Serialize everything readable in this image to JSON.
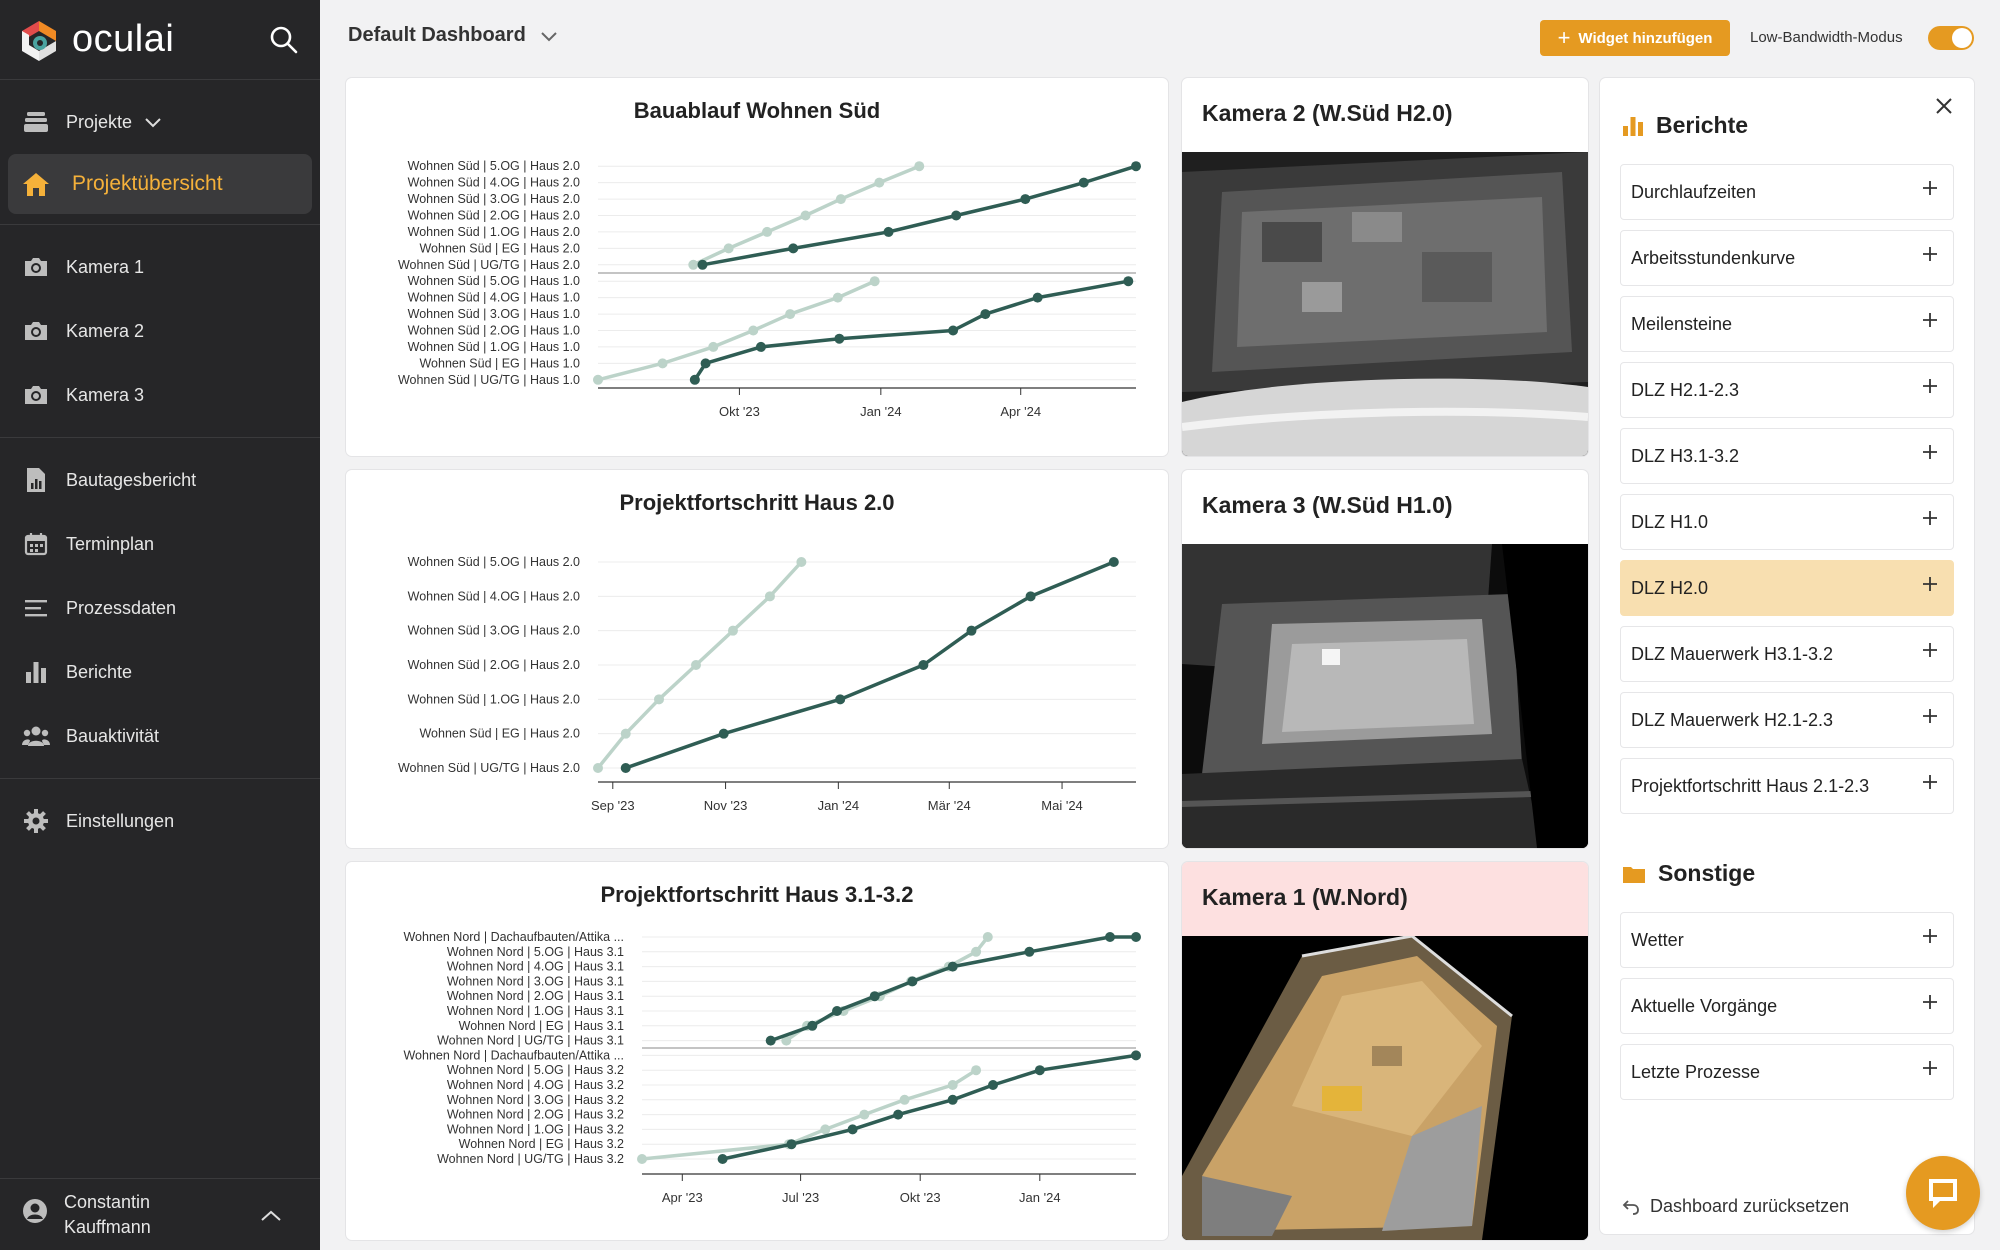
{
  "brand": {
    "name": "oculai"
  },
  "sidebar": {
    "projects": "Projekte",
    "overview": "Projektübersicht",
    "cameras": [
      "Kamera 1",
      "Kamera 2",
      "Kamera 3"
    ],
    "tools": [
      "Bautagesbericht",
      "Terminplan",
      "Prozessdaten",
      "Berichte",
      "Bauaktivität"
    ],
    "settings": "Einstellungen",
    "user": {
      "first": "Constantin",
      "last": "Kauffmann"
    }
  },
  "topbar": {
    "dashboard": "Default Dashboard",
    "add_widget": "Widget hinzufügen",
    "low_bandwidth": "Low-Bandwidth-Modus",
    "low_bandwidth_on": true
  },
  "colors": {
    "accent": "#e59a21",
    "plan": "#bcd3c9",
    "actual": "#2f5d54",
    "camera1_header": "#fde0e0"
  },
  "cameras": {
    "cam2": {
      "title": "Kamera 2 (W.Süd H2.0)"
    },
    "cam3": {
      "title": "Kamera 3 (W.Süd H1.0)"
    },
    "cam1": {
      "title": "Kamera 1 (W.Nord)"
    }
  },
  "chart_data": [
    {
      "type": "line",
      "title": "Bauablauf Wohnen Süd",
      "x_ticks": [
        "Okt '23",
        "Jan '24",
        "Apr '24"
      ],
      "x_range": [
        "2023-07-01",
        "2024-06-15"
      ],
      "categories": [
        "Wohnen Süd | 5.OG | Haus 2.0",
        "Wohnen Süd | 4.OG | Haus 2.0",
        "Wohnen Süd | 3.OG | Haus 2.0",
        "Wohnen Süd | 2.OG | Haus 2.0",
        "Wohnen Süd | 1.OG | Haus 2.0",
        "Wohnen Süd | EG | Haus 2.0",
        "Wohnen Süd | UG/TG | Haus 2.0",
        "Wohnen Süd | 5.OG | Haus 1.0",
        "Wohnen Süd | 4.OG | Haus 1.0",
        "Wohnen Süd | 3.OG | Haus 1.0",
        "Wohnen Süd | 2.OG | Haus 1.0",
        "Wohnen Süd | 1.OG | Haus 1.0",
        "Wohnen Süd | EG | Haus 1.0",
        "Wohnen Süd | UG/TG | Haus 1.0"
      ],
      "series": [
        {
          "role": "plan",
          "values": [
            [
              "2023-09-01",
              6.5
            ],
            [
              "2023-09-24",
              5.5
            ],
            [
              "2023-10-19",
              4.5
            ],
            [
              "2023-11-13",
              3.5
            ],
            [
              "2023-12-06",
              2.5
            ],
            [
              "2023-12-31",
              1.5
            ],
            [
              "2024-01-26",
              0.5
            ]
          ],
          "group": 0
        },
        {
          "role": "actual",
          "values": [
            [
              "2023-09-07",
              6.5
            ],
            [
              "2023-11-05",
              5.5
            ],
            [
              "2024-01-06",
              4.5
            ],
            [
              "2024-02-19",
              3.5
            ],
            [
              "2024-04-04",
              2.5
            ],
            [
              "2024-05-12",
              1.5
            ],
            [
              "2024-06-15",
              0.5
            ]
          ],
          "group": 0
        },
        {
          "role": "plan",
          "values": [
            [
              "2023-07-01",
              13.5
            ],
            [
              "2023-08-12",
              12.5
            ],
            [
              "2023-09-14",
              11.5
            ],
            [
              "2023-10-10",
              10.5
            ],
            [
              "2023-11-03",
              9.5
            ],
            [
              "2023-12-04",
              8.5
            ],
            [
              "2023-12-28",
              7.5
            ]
          ],
          "group": 1
        },
        {
          "role": "actual",
          "values": [
            [
              "2023-09-02",
              13.5
            ],
            [
              "2023-09-09",
              12.5
            ],
            [
              "2023-10-15",
              11.5
            ],
            [
              "2023-12-05",
              11.0
            ],
            [
              "2024-02-17",
              10.5
            ],
            [
              "2024-03-09",
              9.5
            ],
            [
              "2024-04-12",
              8.5
            ],
            [
              "2024-06-10",
              7.5
            ]
          ],
          "group": 1
        }
      ]
    },
    {
      "type": "line",
      "title": "Projektfortschritt Haus 2.0",
      "x_ticks": [
        "Sep '23",
        "Nov '23",
        "Jan '24",
        "Mär '24",
        "Mai '24"
      ],
      "x_range": [
        "2023-08-24",
        "2024-06-10"
      ],
      "categories": [
        "Wohnen Süd | 5.OG | Haus 2.0",
        "Wohnen Süd | 4.OG | Haus 2.0",
        "Wohnen Süd | 3.OG | Haus 2.0",
        "Wohnen Süd | 2.OG | Haus 2.0",
        "Wohnen Süd | 1.OG | Haus 2.0",
        "Wohnen Süd | EG | Haus 2.0",
        "Wohnen Süd | UG/TG | Haus 2.0"
      ],
      "series": [
        {
          "role": "plan",
          "values": [
            [
              "2023-08-24",
              6.0
            ],
            [
              "2023-09-08",
              5.0
            ],
            [
              "2023-09-26",
              4.0
            ],
            [
              "2023-10-16",
              3.0
            ],
            [
              "2023-11-05",
              2.0
            ],
            [
              "2023-11-25",
              1.0
            ],
            [
              "2023-12-12",
              0.0
            ]
          ],
          "group": 0
        },
        {
          "role": "actual",
          "values": [
            [
              "2023-09-08",
              6.0
            ],
            [
              "2023-10-31",
              5.0
            ],
            [
              "2024-01-02",
              4.0
            ],
            [
              "2024-02-16",
              3.0
            ],
            [
              "2024-03-13",
              2.0
            ],
            [
              "2024-04-14",
              1.0
            ],
            [
              "2024-05-29",
              0.0
            ]
          ],
          "group": 0
        }
      ]
    },
    {
      "type": "line",
      "title": "Projektfortschritt Haus 3.1-3.2",
      "x_ticks": [
        "Apr '23",
        "Jul '23",
        "Okt '23",
        "Jan '24"
      ],
      "x_range": [
        "2023-03-01",
        "2024-03-15"
      ],
      "categories": [
        "Wohnen Nord | Dachaufbauten/Attika ...",
        "Wohnen Nord | 5.OG | Haus 3.1",
        "Wohnen Nord | 4.OG | Haus 3.1",
        "Wohnen Nord | 3.OG | Haus 3.1",
        "Wohnen Nord | 2.OG | Haus 3.1",
        "Wohnen Nord | 1.OG | Haus 3.1",
        "Wohnen Nord | EG | Haus 3.1",
        "Wohnen Nord | UG/TG | Haus 3.1",
        "Wohnen Nord | Dachaufbauten/Attika ...",
        "Wohnen Nord | 5.OG | Haus 3.2",
        "Wohnen Nord | 4.OG | Haus 3.2",
        "Wohnen Nord | 3.OG | Haus 3.2",
        "Wohnen Nord | 2.OG | Haus 3.2",
        "Wohnen Nord | 1.OG | Haus 3.2",
        "Wohnen Nord | EG | Haus 3.2",
        "Wohnen Nord | UG/TG | Haus 3.2"
      ],
      "series": [
        {
          "role": "plan",
          "values": [
            [
              "2023-06-20",
              7.0
            ],
            [
              "2023-07-06",
              6.0
            ],
            [
              "2023-08-03",
              5.0
            ],
            [
              "2023-08-31",
              4.0
            ],
            [
              "2023-09-24",
              3.0
            ],
            [
              "2023-10-23",
              2.0
            ],
            [
              "2023-11-13",
              1.0
            ],
            [
              "2023-11-22",
              0.0
            ]
          ],
          "group": 0
        },
        {
          "role": "actual",
          "values": [
            [
              "2023-06-08",
              7.0
            ],
            [
              "2023-07-10",
              6.0
            ],
            [
              "2023-07-29",
              5.0
            ],
            [
              "2023-08-27",
              4.0
            ],
            [
              "2023-09-25",
              3.0
            ],
            [
              "2023-10-26",
              2.0
            ],
            [
              "2023-12-24",
              1.0
            ],
            [
              "2024-02-24",
              0.0
            ],
            [
              "2024-03-15",
              0.0
            ]
          ],
          "group": 0
        },
        {
          "role": "plan",
          "values": [
            [
              "2023-03-01",
              15.0
            ],
            [
              "2023-06-22",
              14.0
            ],
            [
              "2023-07-20",
              13.0
            ],
            [
              "2023-08-19",
              12.0
            ],
            [
              "2023-09-19",
              11.0
            ],
            [
              "2023-10-26",
              10.0
            ],
            [
              "2023-11-13",
              9.0
            ]
          ],
          "group": 1
        },
        {
          "role": "actual",
          "values": [
            [
              "2023-05-02",
              15.0
            ],
            [
              "2023-06-24",
              14.0
            ],
            [
              "2023-08-10",
              13.0
            ],
            [
              "2023-09-14",
              12.0
            ],
            [
              "2023-10-26",
              11.0
            ],
            [
              "2023-11-26",
              10.0
            ],
            [
              "2024-01-01",
              9.0
            ],
            [
              "2024-03-15",
              8.0
            ]
          ],
          "group": 1
        }
      ]
    }
  ],
  "panel": {
    "reports_title": "Berichte",
    "reports": [
      "Durchlaufzeiten",
      "Arbeitsstundenkurve",
      "Meilensteine",
      "DLZ H2.1-2.3",
      "DLZ H3.1-3.2",
      "DLZ H1.0",
      "DLZ H2.0",
      "DLZ Mauerwerk H3.1-3.2",
      "DLZ Mauerwerk H2.1-2.3",
      "Projektfortschritt Haus 2.1-2.3"
    ],
    "selected_report": "DLZ H2.0",
    "other_title": "Sonstige",
    "other": [
      "Wetter",
      "Aktuelle Vorgänge",
      "Letzte Prozesse"
    ],
    "reset": "Dashboard zurücksetzen"
  }
}
